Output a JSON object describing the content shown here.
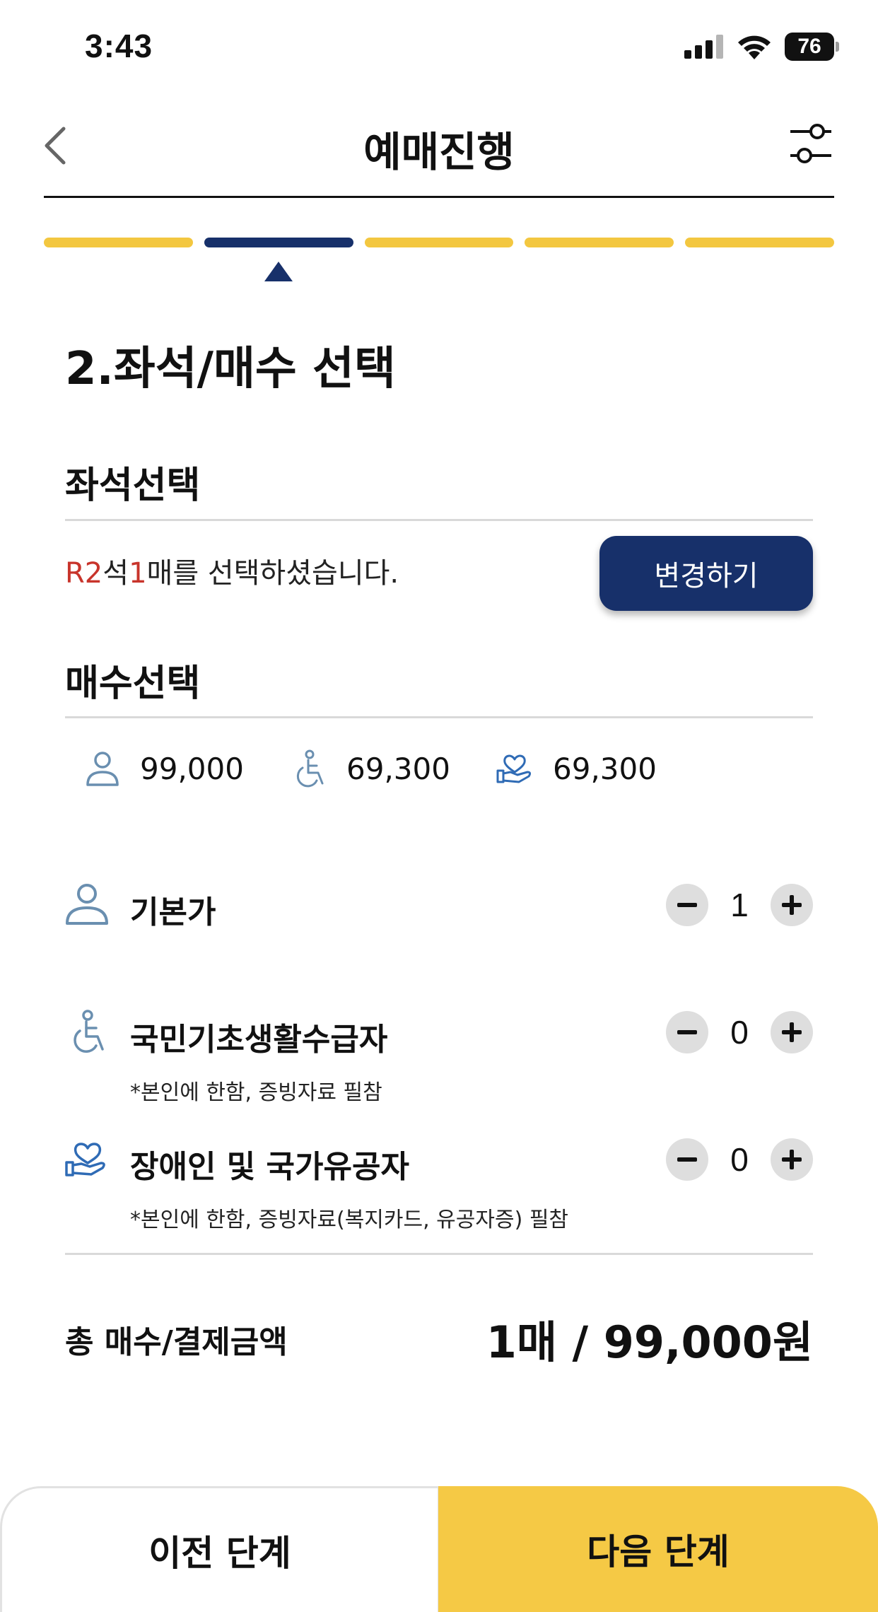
{
  "status_bar": {
    "time": "3:43",
    "battery": "76"
  },
  "header": {
    "title": "예매진행"
  },
  "progress": {
    "total_steps": 5,
    "current_step": 2
  },
  "step_title": "2.좌석/매수 선택",
  "seat_section": {
    "title": "좌석선택",
    "grade": "R2",
    "text_a": "석",
    "count": "1",
    "text_b": "매를 선택하셨습니다.",
    "change_button": "변경하기"
  },
  "quantity_section": {
    "title": "매수선택",
    "prices": [
      {
        "icon": "person-icon",
        "price": "99,000"
      },
      {
        "icon": "wheelchair-icon",
        "price": "69,300"
      },
      {
        "icon": "hand-heart-icon",
        "price": "69,300"
      }
    ],
    "tickets": [
      {
        "icon": "person-icon",
        "label": "기본가",
        "note": "",
        "count": "1"
      },
      {
        "icon": "wheelchair-icon",
        "label": "국민기초생활수급자",
        "note": "*본인에 한함, 증빙자료 필참",
        "count": "0"
      },
      {
        "icon": "hand-heart-icon",
        "label": "장애인 및 국가유공자",
        "note": "*본인에 한함, 증빙자료(복지카드, 유공자증) 필참",
        "count": "0"
      }
    ]
  },
  "total": {
    "label": "총 매수/결제금액",
    "value": "1매 / 99,000원"
  },
  "footer": {
    "prev_label": "이전 단계",
    "next_label": "다음 단계"
  },
  "colors": {
    "navy": "#17306a",
    "yellow": "#f3c740",
    "red": "#c8342b",
    "icon_blue": "#6a8fb0"
  }
}
